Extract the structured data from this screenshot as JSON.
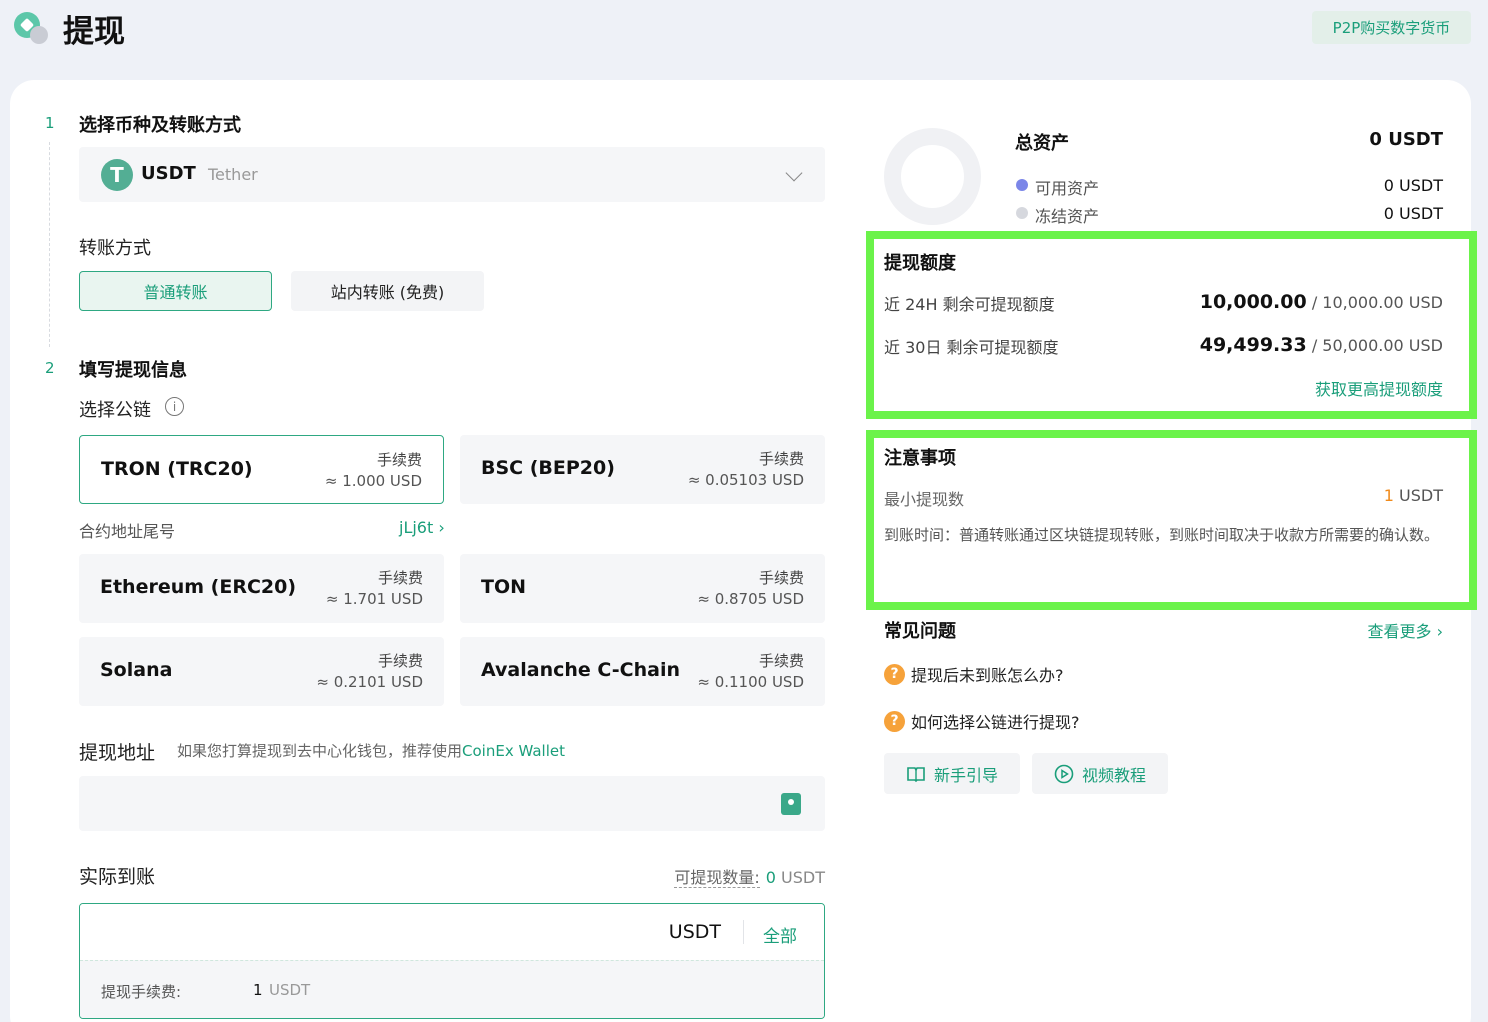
{
  "header": {
    "title": "提现",
    "p2p_button": "P2P购买数字货币"
  },
  "step1": {
    "number": "1",
    "title": "选择币种及转账方式"
  },
  "coin": {
    "symbol": "USDT",
    "name": "Tether",
    "icon_glyph": "T"
  },
  "transfer": {
    "label": "转账方式",
    "options": [
      "普通转账",
      "站内转账 (免费)"
    ],
    "selected": "普通转账"
  },
  "step2": {
    "number": "2",
    "title": "填写提现信息"
  },
  "chain_select": {
    "label": "选择公链",
    "info_glyph": "i",
    "fee_label": "手续费",
    "chains": [
      {
        "name": "TRON (TRC20)",
        "fee": "≈ 1.000 USD",
        "selected": true
      },
      {
        "name": "BSC (BEP20)",
        "fee": "≈ 0.05103 USD"
      },
      {
        "name": "Ethereum (ERC20)",
        "fee": "≈ 1.701 USD"
      },
      {
        "name": "TON",
        "fee": "≈ 0.8705 USD"
      },
      {
        "name": "Solana",
        "fee": "≈ 0.2101 USD"
      },
      {
        "name": "Avalanche C-Chain",
        "fee": "≈ 0.1100 USD"
      }
    ],
    "contract_label": "合约地址尾号",
    "contract_tail": "jLj6t ›"
  },
  "address": {
    "label": "提现地址",
    "hint": "如果您打算提现到去中心化钱包，推荐使用",
    "hint_link": "CoinEx Wallet",
    "value": ""
  },
  "actual": {
    "label": "实际到账",
    "available_label": "可提现数量:",
    "available_value": "0",
    "available_unit": "USDT",
    "unit": "USDT",
    "all_button": "全部",
    "fee_label": "提现手续费:",
    "fee_value": "1",
    "fee_unit": "USDT"
  },
  "assets": {
    "total_label": "总资产",
    "total_value": "0 USDT",
    "available_label": "可用资产",
    "available_value": "0 USDT",
    "frozen_label": "冻结资产",
    "frozen_value": "0 USDT",
    "available_color": "#7b86e8",
    "frozen_color": "#d6d8de"
  },
  "limits": {
    "title": "提现额度",
    "day_label": "近 24H 剩余可提现额度",
    "day_remaining": "10,000.00",
    "day_total": "/ 10,000.00 USD",
    "month_label": "近 30日 剩余可提现额度",
    "month_remaining": "49,499.33",
    "month_total": "/ 50,000.00 USD",
    "more_link": "获取更高提现额度"
  },
  "notes": {
    "title": "注意事项",
    "min_label": "最小提现数",
    "min_value": "1",
    "min_unit": "USDT",
    "arrival_text": "到账时间：普通转账通过区块链提现转账，到账时间取决于收款方所需要的确认数。"
  },
  "faq": {
    "title": "常见问题",
    "more": "查看更多 ›",
    "q_glyph": "?",
    "items": [
      "提现后未到账怎么办?",
      "如何选择公链进行提现?"
    ],
    "guide_button": "新手引导",
    "video_button": "视频教程"
  },
  "colors": {
    "accent": "#1a9e7a",
    "highlight": "#6bf34a",
    "warning": "#f08a1b"
  }
}
